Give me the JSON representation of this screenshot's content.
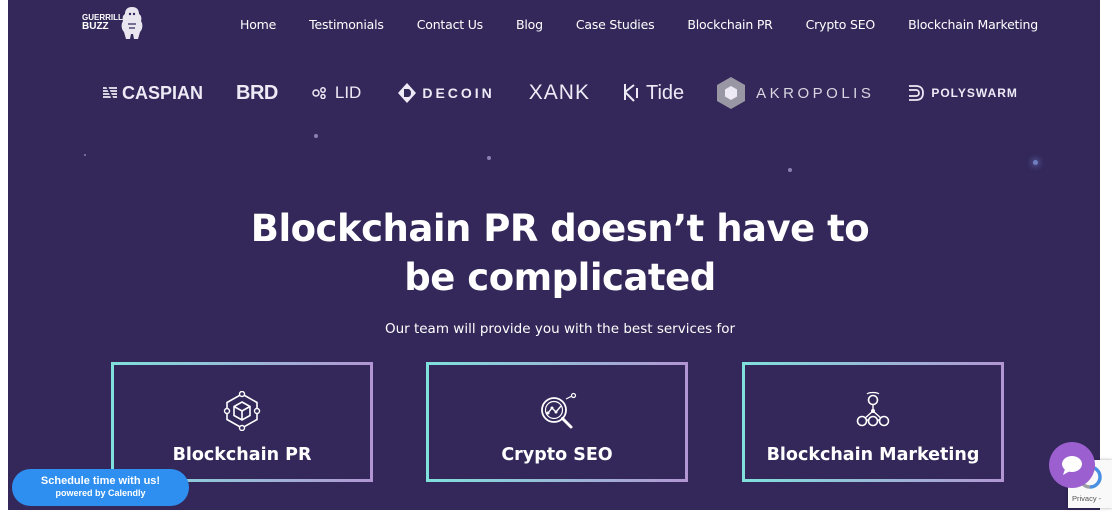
{
  "logo": {
    "line1": "GUERRILLA",
    "line2": "BUZZ"
  },
  "nav": [
    "Home",
    "Testimonials",
    "Contact Us",
    "Blog",
    "Case Studies",
    "Blockchain PR",
    "Crypto SEO",
    "Blockchain Marketing"
  ],
  "partners": [
    {
      "name": "CASPIAN",
      "icon": "caspian-logo-icon"
    },
    {
      "name": "BRD",
      "icon": ""
    },
    {
      "name": "LID",
      "icon": "lid-logo-icon"
    },
    {
      "name": "DECOIN",
      "icon": "decoin-logo-icon"
    },
    {
      "name": "XANK",
      "icon": ""
    },
    {
      "name": "Tide",
      "icon": "tide-logo-icon"
    },
    {
      "name": "AKROPOLIS",
      "icon": "akropolis-hexagon-icon"
    },
    {
      "name": "POLYSWARM",
      "icon": "polyswarm-logo-icon"
    }
  ],
  "hero": {
    "title_line1": "Blockchain PR doesn’t have to",
    "title_line2": "be complicated",
    "subtitle": "Our team will provide you with the best services for"
  },
  "services": [
    {
      "label": "Blockchain PR",
      "icon": "cube-network-icon"
    },
    {
      "label": "Crypto SEO",
      "icon": "magnifier-chart-icon"
    },
    {
      "label": "Blockchain Marketing",
      "icon": "network-nodes-icon"
    }
  ],
  "calendly": {
    "line1": "Schedule time with us!",
    "line2": "powered by Calendly"
  },
  "recaptcha": {
    "label": "Privacy -"
  },
  "colors": {
    "background": "#34285a",
    "card_gradient_start": "#7fe0dc",
    "card_gradient_end": "#b196d3",
    "calendly": "#2e8ff0",
    "chat": "#9b5fcf"
  }
}
